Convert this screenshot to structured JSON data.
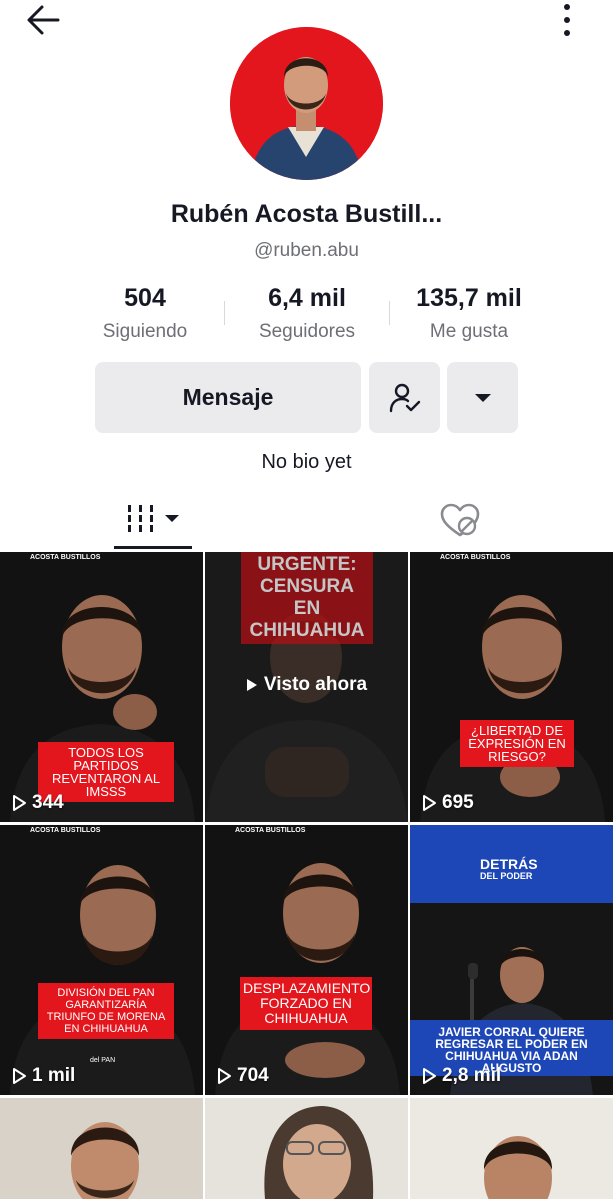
{
  "topbar": {
    "back_icon": "arrow-left-icon",
    "more_icon": "more-vertical-icon"
  },
  "profile": {
    "name": "Rubén Acosta Bustill...",
    "handle": "@ruben.abu",
    "bio": "No bio yet",
    "avatar_bg": "#e3161d"
  },
  "stats": {
    "following": {
      "value": "504",
      "label": "Siguiendo"
    },
    "followers": {
      "value": "6,4 mil",
      "label": "Seguidores"
    },
    "likes": {
      "value": "135,7 mil",
      "label": "Me gusta"
    }
  },
  "actions": {
    "message_label": "Mensaje",
    "follow_icon": "user-check-icon",
    "dropdown_icon": "caret-down-icon"
  },
  "tabs": {
    "videos_icon": "videos-grid-icon",
    "liked_icon": "heart-hidden-icon"
  },
  "videos": [
    {
      "brand": "ACOSTA BUSTILLOS",
      "caption": "TODOS LOS PARTIDOS REVENTARON AL IMSSS",
      "views": "344"
    },
    {
      "title": "URGENTE: CENSURA EN CHIHUAHUA",
      "watched_label": "Visto ahora"
    },
    {
      "brand": "ACOSTA BUSTILLOS",
      "caption": "¿LIBERTAD DE EXPRESIÓN EN RIESGO?",
      "views": "695"
    },
    {
      "brand": "ACOSTA BUSTILLOS",
      "caption": "DIVISIÓN DEL PAN GARANTIZARÍA TRIUNFO DE MORENA EN CHIHUAHUA",
      "tag": "del PAN",
      "views": "1 mil"
    },
    {
      "brand": "ACOSTA BUSTILLOS",
      "caption": "DESPLAZAMIENTO FORZADO EN CHIHUAHUA",
      "views": "704"
    },
    {
      "logo_line1": "DETRÁS",
      "logo_line2": "DEL PODER",
      "caption": "JAVIER CORRAL QUIERE REGRESAR EL PODER EN CHIHUAHUA VIA ADAN AUGUSTO",
      "views": "2,8 mil"
    }
  ],
  "colors": {
    "accent_red": "#e3161d",
    "text_primary": "#161823",
    "text_secondary": "#6e6f76",
    "button_bg": "#ebebed",
    "detras_blue": "#1d47b6"
  }
}
